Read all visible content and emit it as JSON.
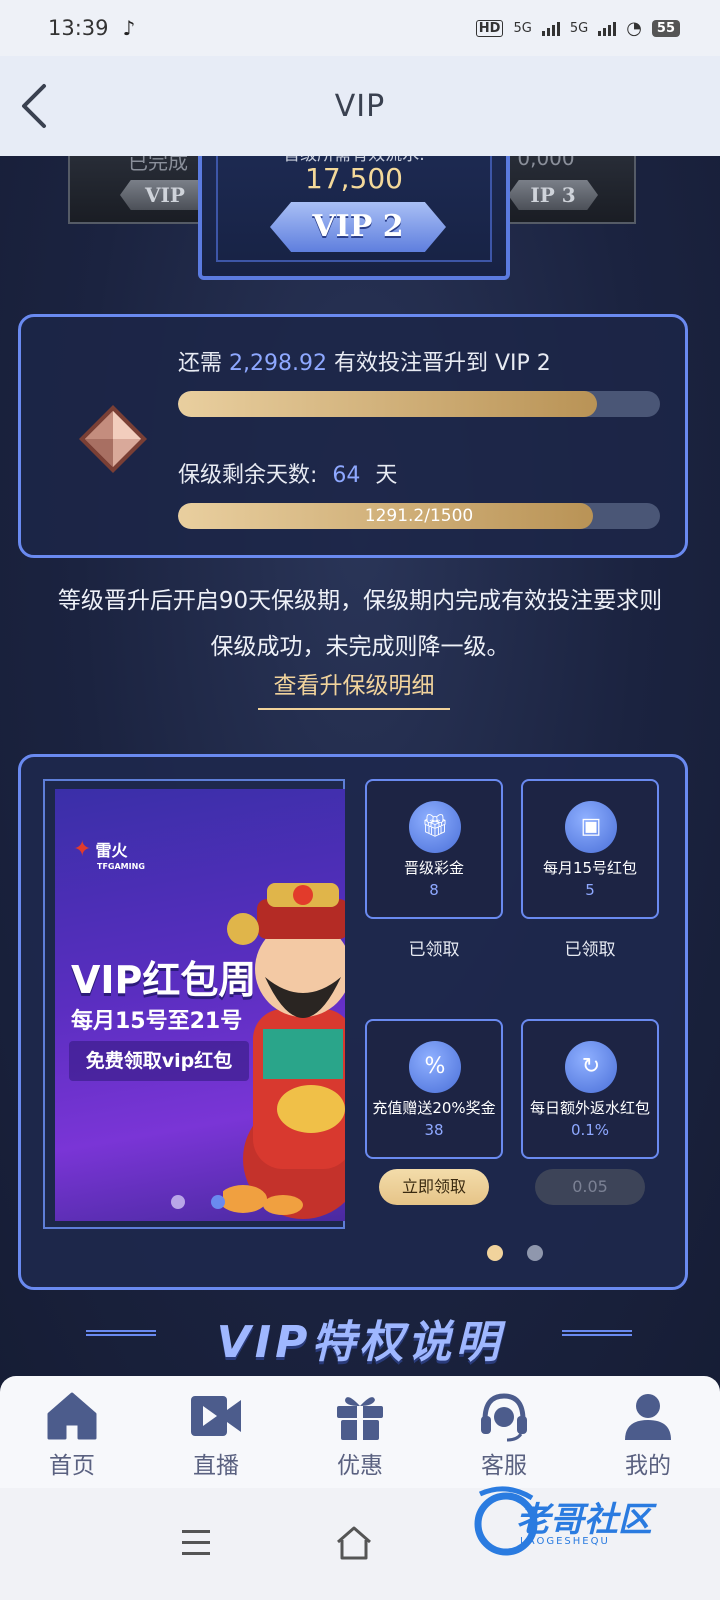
{
  "status_bar": {
    "time": "13:39",
    "network1": "5G",
    "network2": "5G",
    "hd_label": "HD",
    "battery": "55"
  },
  "header": {
    "title": "VIP"
  },
  "vip_levels": {
    "left_top": "已完成",
    "left_badge": "VIP",
    "center_label": "晋级所需有效流水:",
    "center_value": "17,500",
    "center_badge": "VIP 2",
    "right_top": "0,000",
    "right_badge": "IP 3"
  },
  "progress": {
    "prefix": "还需",
    "amount": "2,298.92",
    "suffix": "有效投注晋升到 VIP 2",
    "upgrade_fraction": 0.87,
    "keep_label": "保级剩余天数:",
    "days": "64",
    "days_unit": "天",
    "keep_text": "1291.2/1500",
    "keep_fraction": 0.86
  },
  "description": {
    "line1": "等级晋升后开启90天保级期，保级期内完成有效投注要求则",
    "line2": "保级成功，未完成则降一级。",
    "link": "查看升保级明细"
  },
  "banner": {
    "logo": "雷火",
    "logo_sub": "TFGAMING",
    "title": "VIP红包周",
    "subtitle": "每月15号至21号",
    "button": "免费领取vip红包"
  },
  "rewards": [
    {
      "name": "晋级彩金",
      "value": "8",
      "icon": "gift-icon",
      "status": "已领取"
    },
    {
      "name": "每月15号红包",
      "value": "5",
      "icon": "red-packet-icon",
      "status": "已领取"
    },
    {
      "name": "充值赠送20%奖金",
      "value": "38",
      "icon": "coupon-icon",
      "status": "立即领取"
    },
    {
      "name": "每日额外返水红包",
      "value": "0.1%",
      "icon": "rebate-icon",
      "status": "0.05"
    }
  ],
  "section_title": "VIP特权说明",
  "bottom_nav": [
    {
      "label": "首页",
      "icon": "home-icon"
    },
    {
      "label": "直播",
      "icon": "video-icon"
    },
    {
      "label": "优惠",
      "icon": "gift-icon"
    },
    {
      "label": "客服",
      "icon": "headset-icon"
    },
    {
      "label": "我的",
      "icon": "user-icon"
    }
  ],
  "watermark": {
    "text": "老哥社区",
    "sub": "LAOGESHEQU"
  },
  "colors": {
    "accent": "#6a8af0",
    "gold": "#f1d39c",
    "highlight": "#8ea8ff",
    "background": "#1c2440"
  }
}
